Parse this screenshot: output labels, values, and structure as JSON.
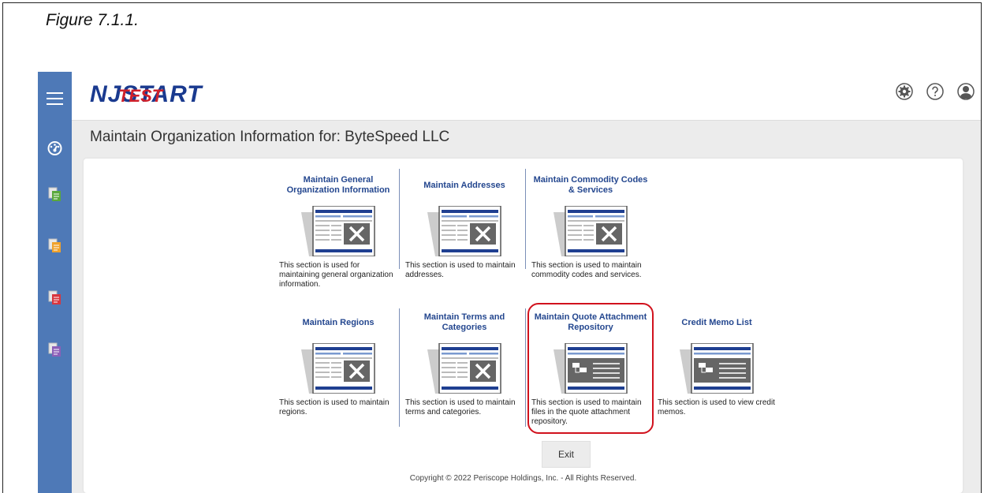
{
  "figure_caption": "Figure 7.1.1.",
  "header": {
    "logo_main": "NJSTART",
    "logo_overlay": "TEST",
    "icons": [
      "settings-icon",
      "help-icon",
      "user-icon"
    ]
  },
  "sidebar": {
    "menu_icon": "hamburger-icon",
    "items": [
      "dashboard-icon",
      "green-document-icon",
      "orange-document-icon",
      "red-document-icon",
      "purple-document-icon"
    ]
  },
  "page": {
    "heading": "Maintain Organization Information for: ByteSpeed LLC"
  },
  "tiles": [
    {
      "title": "Maintain General Organization Information",
      "desc": "This section is used for maintaining general organization information.",
      "icon": "form-tools-icon"
    },
    {
      "title": "Maintain Addresses",
      "desc": "This section is used to maintain addresses.",
      "icon": "form-tools-icon"
    },
    {
      "title": "Maintain Commodity Codes & Services",
      "desc": "This section is used to maintain commodity codes and services.",
      "icon": "form-tools-icon"
    },
    {
      "title": "Maintain Regions",
      "desc": "This section is used to maintain regions.",
      "icon": "form-tools-icon"
    },
    {
      "title": "Maintain Terms and Categories",
      "desc": "This section is used to maintain terms and categories.",
      "icon": "form-tools-icon"
    },
    {
      "title": "Maintain Quote Attachment Repository",
      "desc": "This section is used to maintain files in the quote attachment repository.",
      "icon": "form-list-icon"
    },
    {
      "title": "Credit Memo List",
      "desc": "This section is used to view credit memos.",
      "icon": "form-list-icon"
    }
  ],
  "actions": {
    "exit_label": "Exit"
  },
  "footer": {
    "copyright": "Copyright © 2022 Periscope Holdings, Inc. - All Rights Reserved."
  },
  "colors": {
    "sidebar": "#4e79b7",
    "title_text": "#24478f",
    "highlight": "#d1121d"
  }
}
